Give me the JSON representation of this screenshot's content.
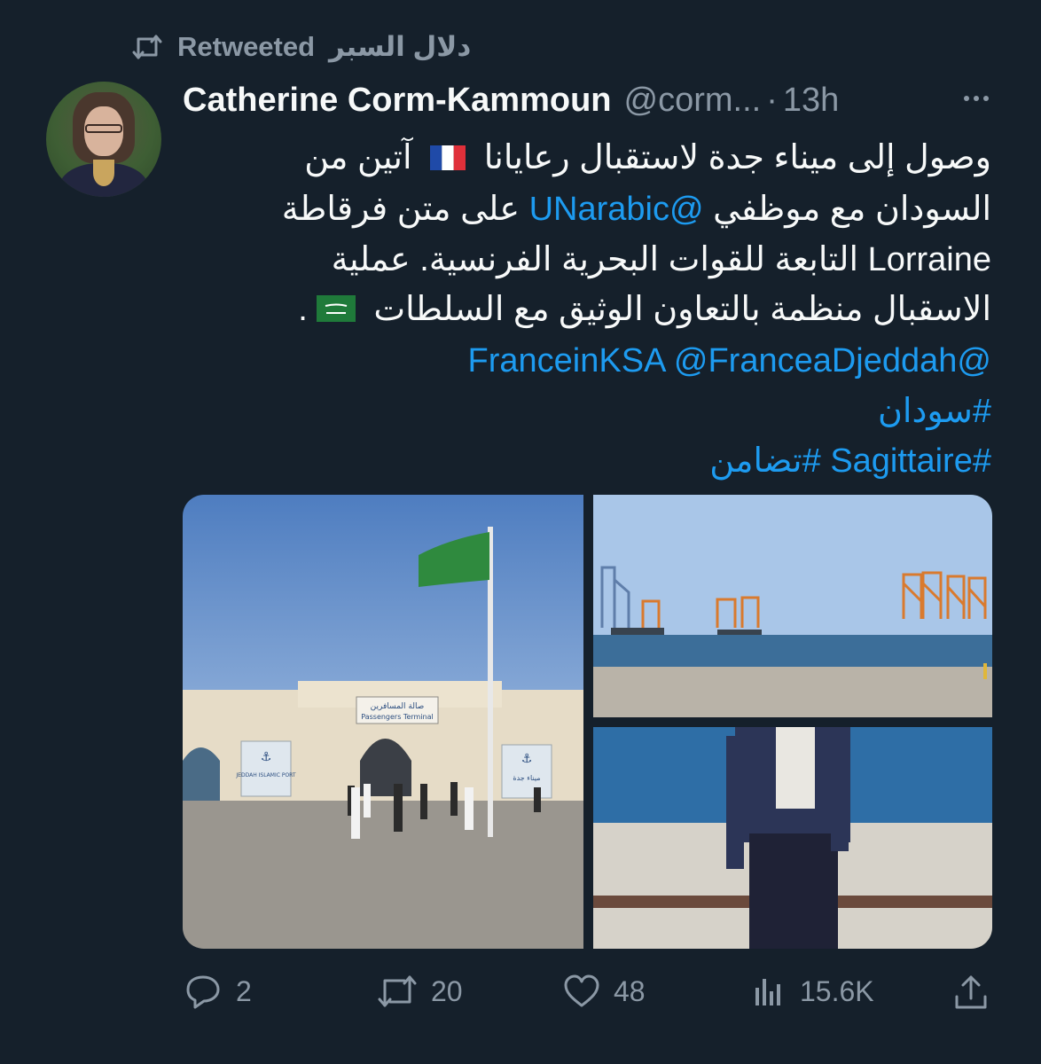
{
  "retweet": {
    "label": "Retweeted",
    "by": "دلال السبر",
    "icon": "retweet-icon"
  },
  "author": {
    "name": "Catherine Corm-Kammoun",
    "handle": "@corm...",
    "time": "13h"
  },
  "tweet": {
    "line1": "وصول إلى ميناء جدة لاستقبال رعايانا",
    "line1_tail": "آتين من",
    "line2_pre": "السودان  مع موظفي",
    "mention_un": "@UNarabic",
    "line2_post": "على متن فرقاطة",
    "line3": "Lorraine التابعة للقوات البحرية الفرنسية. عملية",
    "line4": "الاسقبال منظمة بالتعاون الوثيق مع السلطات",
    "line4_end": ".",
    "mention_2": "@FranceinKSA",
    "mention_1": "@FranceaDjeddah",
    "hashtag_1": "#سودان",
    "hashtag_2": "#Sagittaire",
    "hashtag_3": "#تضامن",
    "flag_fr": "flag-france-icon",
    "flag_sa": "flag-saudi-icon"
  },
  "images": {
    "terminal_sign_ar": "صالة المسافرين",
    "terminal_sign_en": "Passengers Terminal",
    "banner_en": "JEDDAH ISLAMIC PORT",
    "banner_ar": "ميناء جدة"
  },
  "actions": {
    "replies": "2",
    "retweets": "20",
    "likes": "48",
    "views": "15.6K"
  },
  "colors": {
    "background": "#15202b",
    "text": "#f7f9f9",
    "muted": "#8b98a5",
    "link": "#1d9bf0"
  }
}
